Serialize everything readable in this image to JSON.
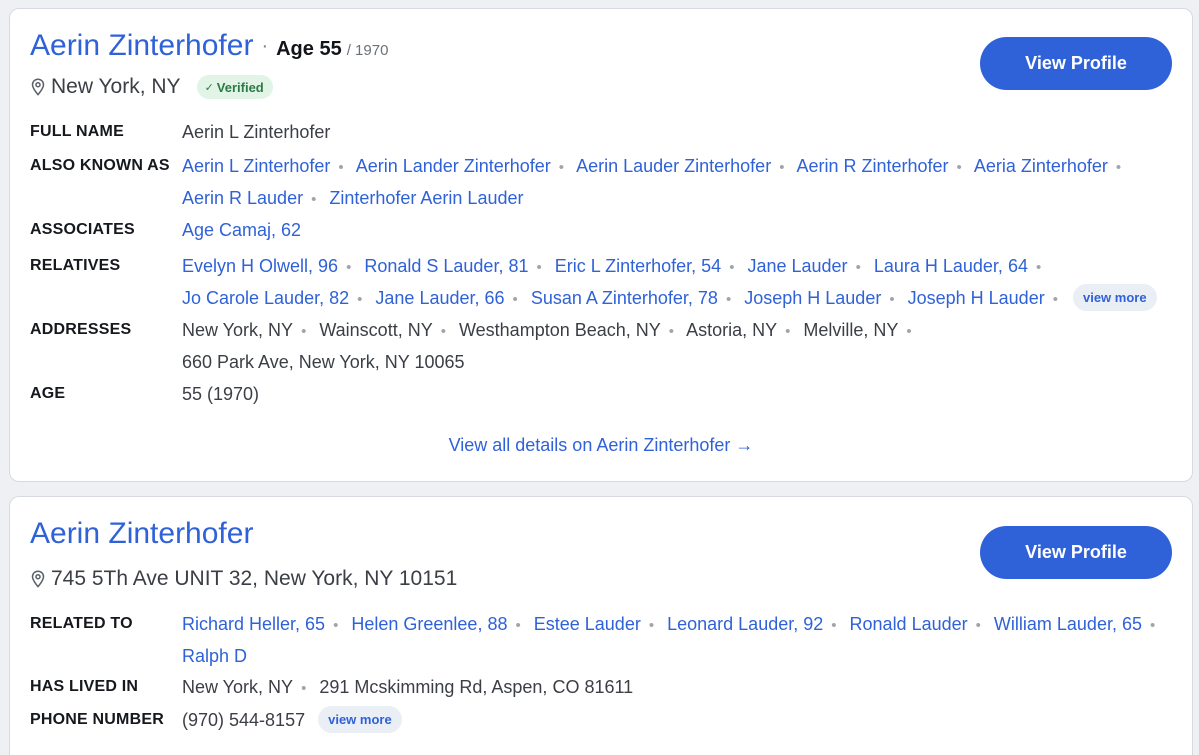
{
  "cards": [
    {
      "name": "Aerin Zinterhofer",
      "age": "Age 55",
      "birth_year": "/ 1970",
      "location": "New York, NY",
      "verified": "Verified",
      "button": "View Profile",
      "fields": {
        "full_name_label": "FULL NAME",
        "full_name": "Aerin L Zinterhofer",
        "aka_label": "ALSO KNOWN AS",
        "aka": [
          "Aerin L Zinterhofer",
          "Aerin Lander Zinterhofer",
          "Aerin Lauder Zinterhofer",
          "Aerin R Zinterhofer",
          "Aeria Zinterhofer",
          "Aerin R Lauder",
          "Zinterhofer Aerin Lauder"
        ],
        "associates_label": "ASSOCIATES",
        "associates": [
          "Age Camaj, 62"
        ],
        "relatives_label": "RELATIVES",
        "relatives": [
          "Evelyn H Olwell, 96",
          "Ronald S Lauder, 81",
          "Eric L Zinterhofer, 54",
          "Jane Lauder",
          "Laura H Lauder, 64",
          "Jo Carole Lauder, 82",
          "Jane Lauder, 66",
          "Susan A Zinterhofer, 78",
          "Joseph H Lauder",
          "Joseph H Lauder"
        ],
        "relatives_more": "view more",
        "addresses_label": "ADDRESSES",
        "addresses": [
          "New York, NY",
          "Wainscott, NY",
          "Westhampton Beach, NY",
          "Astoria, NY",
          "Melville, NY",
          "660 Park Ave, New York, NY 10065"
        ],
        "age_label": "AGE",
        "age_value": "55 (1970)"
      },
      "details_link": "View all details on Aerin Zinterhofer →"
    },
    {
      "name": "Aerin Zinterhofer",
      "location": "745 5Th Ave UNIT 32, New York, NY 10151",
      "button": "View Profile",
      "fields": {
        "related_label": "RELATED TO",
        "related": [
          "Richard Heller, 65",
          "Helen Greenlee, 88",
          "Estee Lauder",
          "Leonard Lauder, 92",
          "Ronald Lauder",
          "William Lauder, 65",
          "Ralph D"
        ],
        "lived_label": "HAS LIVED IN",
        "lived": [
          "New York, NY",
          "291 Mcskimming Rd, Aspen, CO 81611"
        ],
        "phone_label": "PHONE NUMBER",
        "phone": "(970) 544-8157",
        "phone_more": "view more"
      }
    }
  ],
  "icons": {
    "location": "map-pin-icon",
    "verified": "check-icon",
    "arrow": "arrow-right-icon"
  },
  "colors": {
    "accent": "#2f62d8",
    "verified_bg": "#e1f4e6",
    "verified_text": "#2d7a45"
  }
}
